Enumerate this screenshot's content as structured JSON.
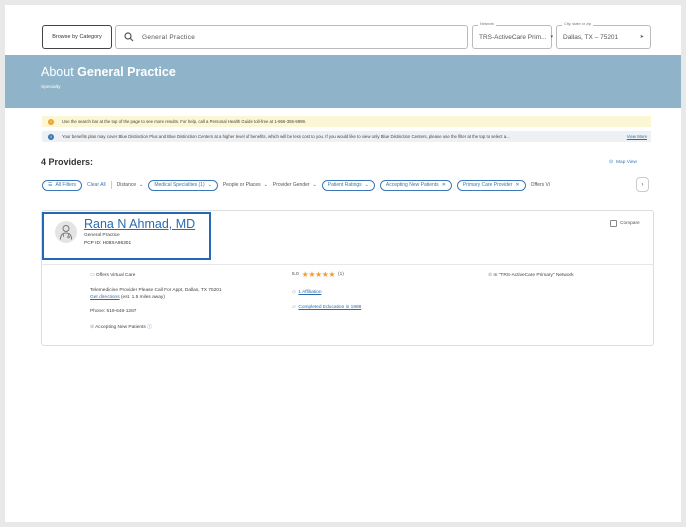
{
  "search": {
    "browse_label": "Browse by Category",
    "query": "General Practice",
    "network_legend": "Network",
    "network_value": "TRS-ActiveCare Prim...",
    "city_legend": "City, state or zip",
    "city_value": "Dallas, TX – 75201"
  },
  "banner": {
    "title_prefix": "About ",
    "title_bold": "General Practice",
    "subtitle": "Specialty"
  },
  "notices": [
    {
      "icon": "!",
      "text": "Use the search bar at the top of the page to see more results. For help, call a Personal Health Guide toll-free at 1-866-355-5999.",
      "link": ""
    },
    {
      "icon": "i",
      "text": "Your benefits plan may cover Blue Distinction Plus and Blue Distinction Centers at a higher level of benefits, which will be less cost to you. If you would like to view only Blue Distinction Centers, please use the filter at the top to select a...",
      "link": "View More"
    }
  ],
  "results": {
    "title": "4 Providers:",
    "map_view": "Map View"
  },
  "filters": {
    "all_filters": "All Filters",
    "clear_all": "Clear All",
    "distance": "Distance",
    "medical_specialties": "Medical Specialties (1)",
    "people_or_places": "People or Places",
    "provider_gender": "Provider Gender",
    "patient_ratings": "Patient Ratings",
    "accepting_new_patients": "Accepting New Patients",
    "primary_care_provider": "Primary Care Provider",
    "offers_virtual": "Offers Vi"
  },
  "provider": {
    "name": "Rana N Ahmad, MD",
    "specialty": "General Practice",
    "pcp_id": "PCP ID: H08XA95301",
    "compare_label": "Compare",
    "virtual_care": "Offers Virtual Care",
    "address_line": "Telemedicine Provider Please Call For Appt, Dallas, TX 75201",
    "directions_link": "Get directions",
    "directions_note": " (est. 1.5 miles away)",
    "phone": "Phone: 619-648-1287",
    "accepting": "Accepting New Patients",
    "rating_value": "5.0",
    "rating_count": "(1)",
    "stars": 5,
    "affiliation": "1 Affiliation",
    "education": "Completed Education in 1988",
    "network_status": "In \"TRS-ActiveCare Primary\" Network"
  },
  "colors": {
    "banner": "#8fb4ca",
    "link": "#2a6bb0",
    "highlight": "#2469b3",
    "star": "#f39c32"
  }
}
